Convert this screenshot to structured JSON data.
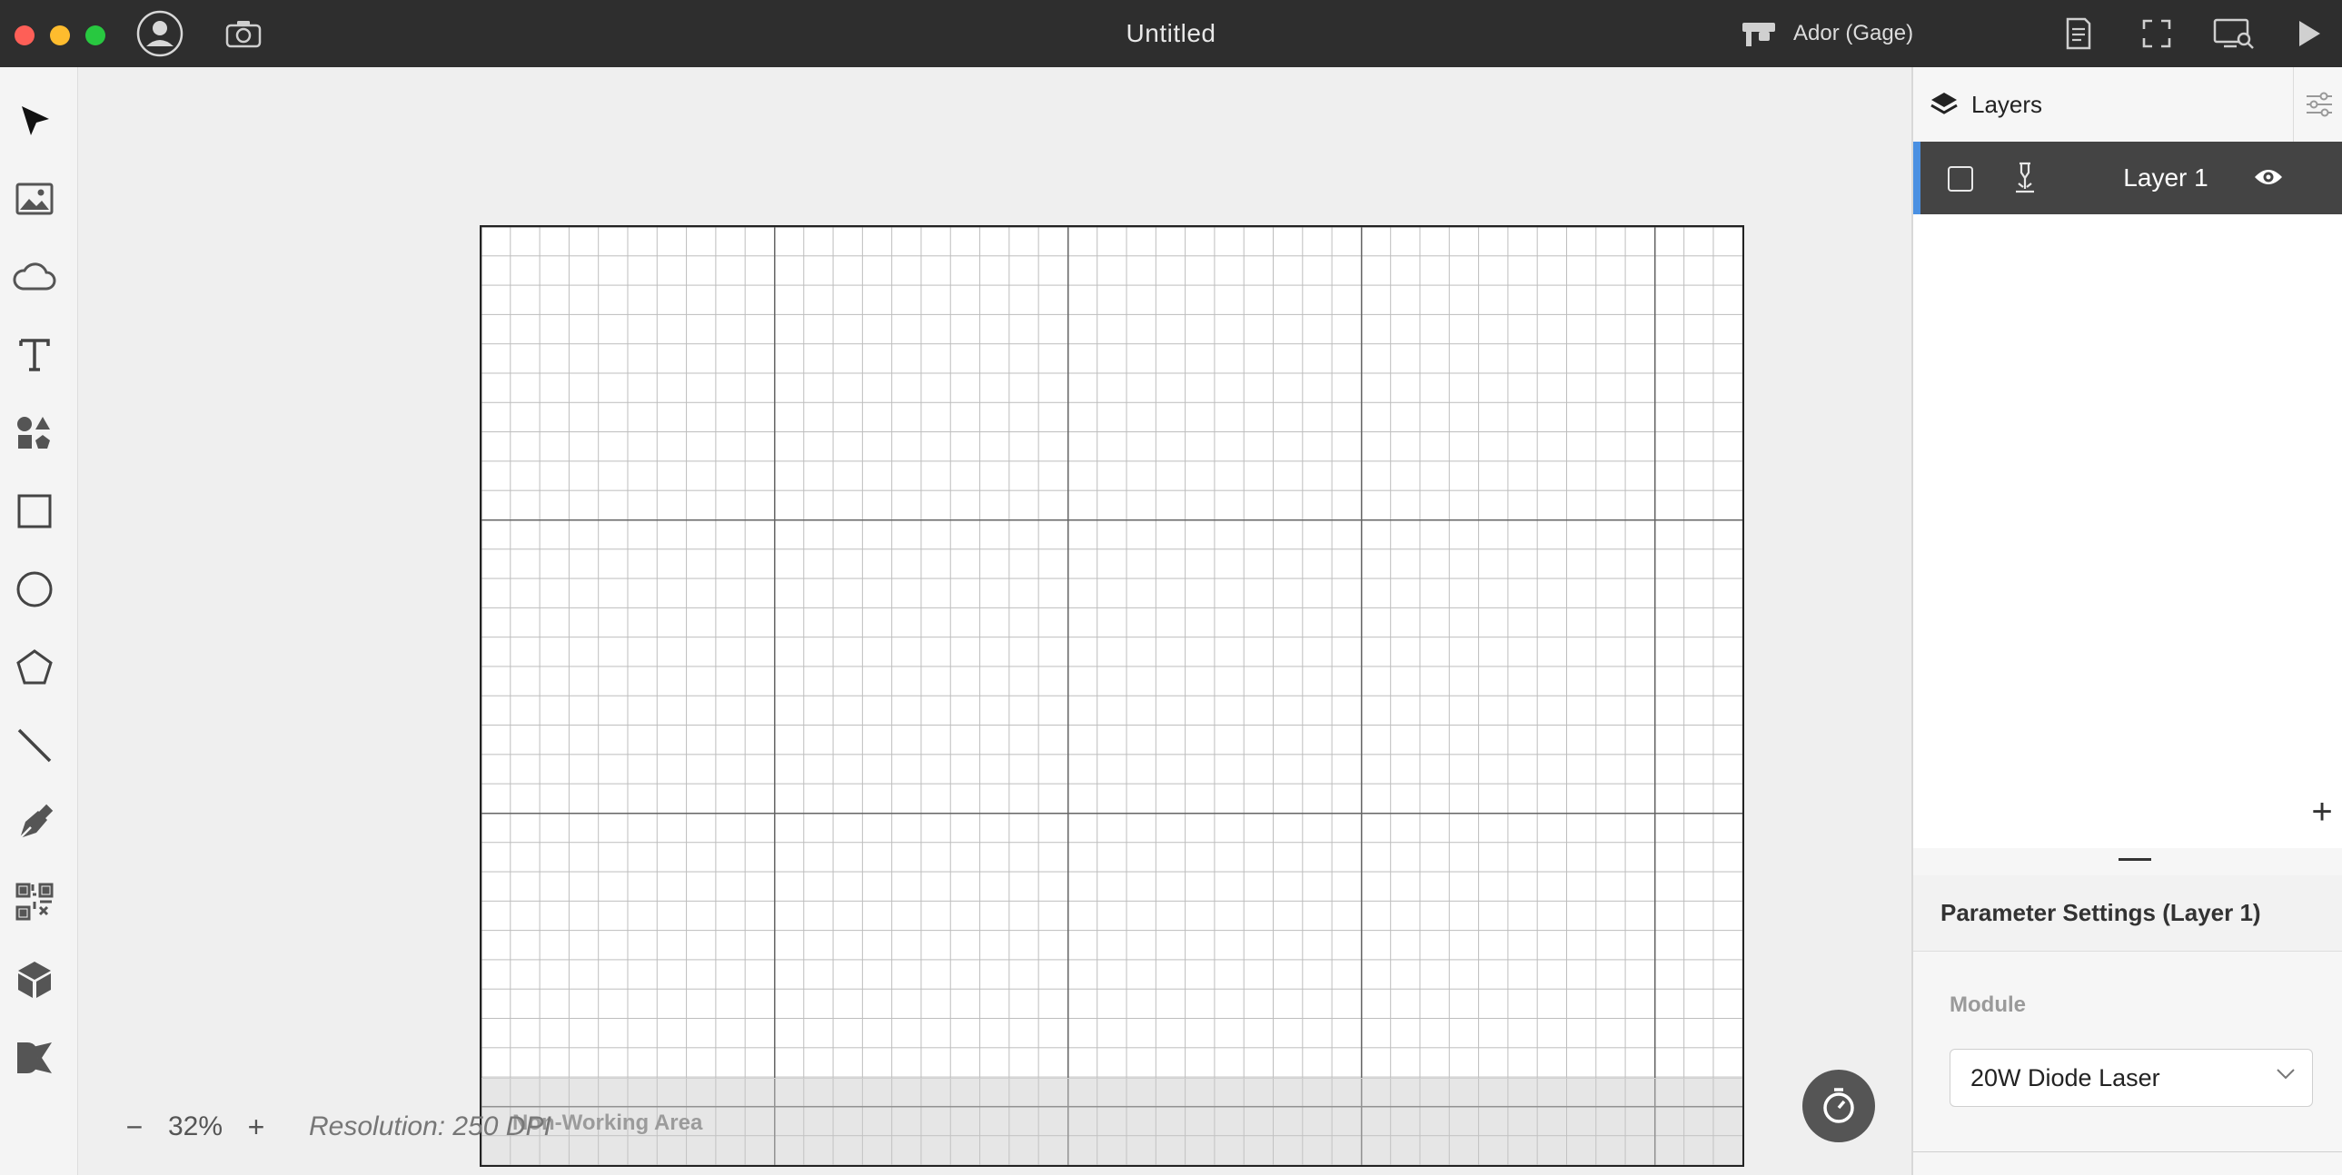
{
  "window": {
    "title": "Untitled",
    "device": "Ador (Gage)"
  },
  "titlebar_icons": [
    "user-account-icon",
    "camera-icon",
    "machine-icon",
    "document-icon",
    "fullscreen-icon",
    "monitor-search-icon",
    "play-icon"
  ],
  "left_toolbar": {
    "tools": [
      "select-tool",
      "image-tool",
      "cloud-tool",
      "text-tool",
      "elements-tool",
      "rectangle-tool",
      "ellipse-tool",
      "polygon-tool",
      "line-tool",
      "pen-tool",
      "qrcode-tool",
      "boxgen-tool",
      "dmkt-tool"
    ]
  },
  "canvas": {
    "non_working_area_label": "Non-Working Area",
    "zoom_minus": "−",
    "zoom_value": "32%",
    "zoom_plus": "+",
    "resolution": "Resolution: 250 DPI"
  },
  "right_panel": {
    "layers_title": "Layers",
    "layers": [
      {
        "name": "Layer 1",
        "selected": true,
        "visible": true
      }
    ],
    "add_layer_label": "+",
    "params_title": "Parameter Settings (Layer 1)",
    "module_label": "Module",
    "module_value": "20W Diode Laser"
  },
  "colors": {
    "titlebar_bg": "#2e2e2e",
    "accent": "#4a90e2",
    "layer_row_bg": "#444444"
  }
}
